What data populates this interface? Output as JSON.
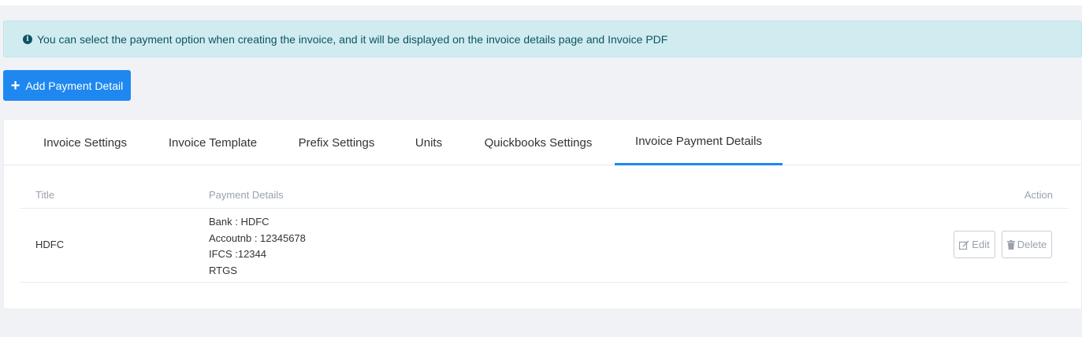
{
  "alert": {
    "icon": "info-icon",
    "text": "You can select the payment option when creating the invoice, and it will be displayed on the invoice details page and Invoice PDF"
  },
  "add_button": {
    "label": "Add Payment Detail",
    "icon": "plus-icon"
  },
  "tabs": [
    {
      "label": "Invoice Settings",
      "active": false
    },
    {
      "label": "Invoice Template",
      "active": false
    },
    {
      "label": "Prefix Settings",
      "active": false
    },
    {
      "label": "Units",
      "active": false
    },
    {
      "label": "Quickbooks Settings",
      "active": false
    },
    {
      "label": "Invoice Payment Details",
      "active": true
    }
  ],
  "table": {
    "columns": [
      "Title",
      "Payment Details",
      "Action"
    ],
    "rows": [
      {
        "title": "HDFC",
        "details": [
          "Bank : HDFC",
          "Accoutnb : 12345678",
          "IFCS :12344",
          "RTGS"
        ],
        "edit_label": "Edit",
        "delete_label": "Delete"
      }
    ]
  },
  "colors": {
    "accent": "#1e88f0",
    "alert_bg": "#d1ecf1",
    "alert_text": "#0c5460"
  }
}
